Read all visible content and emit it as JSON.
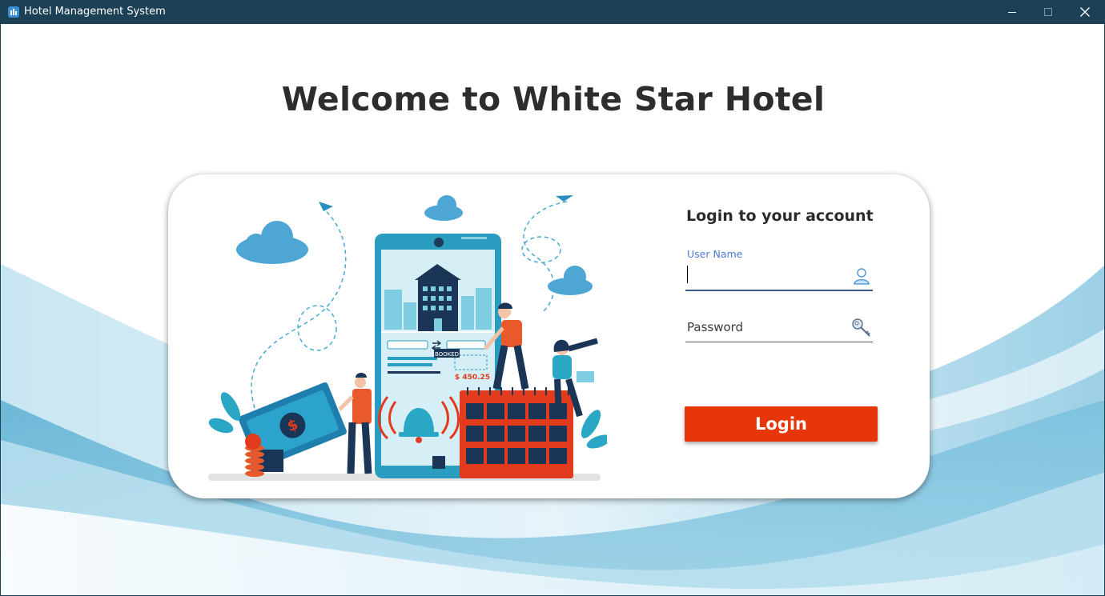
{
  "window": {
    "title": "Hotel Management System",
    "app_icon": "hotel-icon",
    "controls": [
      "minimize-icon",
      "maximize-icon",
      "close-icon"
    ]
  },
  "page": {
    "welcome": "Welcome to White Star Hotel"
  },
  "login": {
    "heading": "Login to your account",
    "username_label": "User Name",
    "username_value": "",
    "username_icon": "user-icon",
    "password_placeholder": "Password",
    "password_value": "",
    "password_icon": "key-icon",
    "button_label": "Login"
  },
  "illustration": {
    "booked_label": "BOOKED",
    "price": "$ 450.25"
  },
  "colors": {
    "titlebar": "#1c4056",
    "login_button": "#e8360b",
    "accent_blue": "#4a7bd0",
    "illustration_teal": "#2aa7c4",
    "illustration_red": "#e23a1c"
  }
}
